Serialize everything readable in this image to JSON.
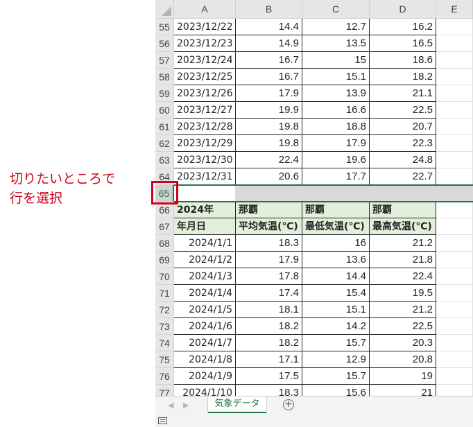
{
  "annotation": {
    "line1": "切りたいところで",
    "line2": "行を選択"
  },
  "columns": [
    "A",
    "B",
    "C",
    "D",
    "E"
  ],
  "rows": [
    {
      "num": "55",
      "a": "2023/12/22",
      "b": "14.4",
      "c": "12.7",
      "d": "16.2"
    },
    {
      "num": "56",
      "a": "2023/12/23",
      "b": "14.9",
      "c": "13.5",
      "d": "16.5"
    },
    {
      "num": "57",
      "a": "2023/12/24",
      "b": "16.7",
      "c": "15",
      "d": "18.6"
    },
    {
      "num": "58",
      "a": "2023/12/25",
      "b": "16.7",
      "c": "15.1",
      "d": "18.2"
    },
    {
      "num": "59",
      "a": "2023/12/26",
      "b": "17.9",
      "c": "13.9",
      "d": "21.1"
    },
    {
      "num": "60",
      "a": "2023/12/27",
      "b": "19.9",
      "c": "16.6",
      "d": "22.5"
    },
    {
      "num": "61",
      "a": "2023/12/28",
      "b": "19.8",
      "c": "18.8",
      "d": "20.7"
    },
    {
      "num": "62",
      "a": "2023/12/29",
      "b": "19.8",
      "c": "17.9",
      "d": "22.3"
    },
    {
      "num": "63",
      "a": "2023/12/30",
      "b": "22.4",
      "c": "19.6",
      "d": "24.8"
    },
    {
      "num": "64",
      "a": "2023/12/31",
      "b": "20.6",
      "c": "17.7",
      "d": "22.7"
    }
  ],
  "selected_row": {
    "num": "65"
  },
  "header_rows": [
    {
      "num": "66",
      "a": "2024年",
      "b": "那覇",
      "c": "那覇",
      "d": "那覇"
    },
    {
      "num": "67",
      "a": "年月日",
      "b": "平均気温(℃)",
      "c": "最低気温(℃)",
      "d": "最高気温(℃)"
    }
  ],
  "rows2": [
    {
      "num": "68",
      "a": "2024/1/1",
      "b": "18.3",
      "c": "16",
      "d": "21.2"
    },
    {
      "num": "69",
      "a": "2024/1/2",
      "b": "17.9",
      "c": "13.6",
      "d": "21.8"
    },
    {
      "num": "70",
      "a": "2024/1/3",
      "b": "17.8",
      "c": "14.4",
      "d": "22.4"
    },
    {
      "num": "71",
      "a": "2024/1/4",
      "b": "17.4",
      "c": "15.4",
      "d": "19.5"
    },
    {
      "num": "72",
      "a": "2024/1/5",
      "b": "18.1",
      "c": "15.1",
      "d": "21.2"
    },
    {
      "num": "73",
      "a": "2024/1/6",
      "b": "18.2",
      "c": "14.2",
      "d": "22.5"
    },
    {
      "num": "74",
      "a": "2024/1/7",
      "b": "18.2",
      "c": "15.7",
      "d": "20.3"
    },
    {
      "num": "75",
      "a": "2024/1/8",
      "b": "17.1",
      "c": "12.9",
      "d": "20.8"
    },
    {
      "num": "76",
      "a": "2024/1/9",
      "b": "17.5",
      "c": "15.7",
      "d": "19"
    },
    {
      "num": "77",
      "a": "2024/1/10",
      "b": "18.3",
      "c": "15.6",
      "d": "21"
    }
  ],
  "tabs": {
    "sheet_name": "気象データ",
    "add_icon": "plus-circle-icon"
  },
  "colors": {
    "accent": "#217346",
    "annotation": "#d0021b",
    "header_fill": "#e2efda"
  }
}
